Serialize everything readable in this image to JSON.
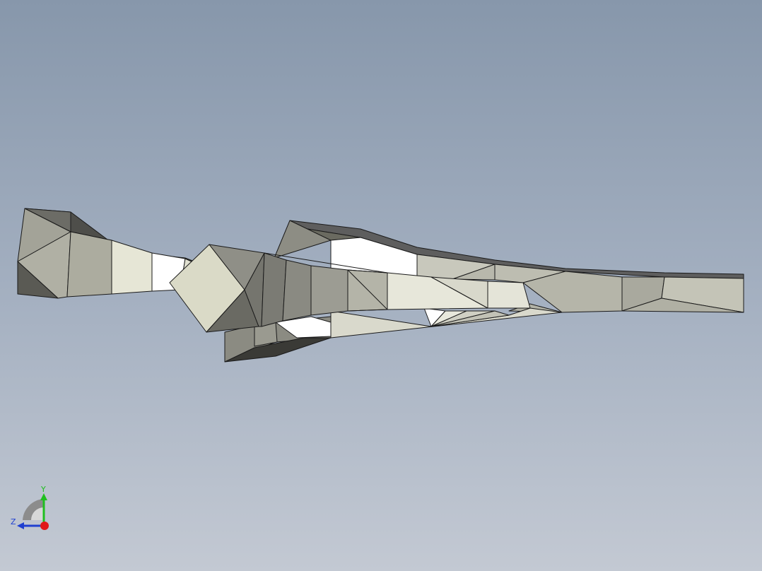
{
  "viewport": {
    "background_top": "#8797ab",
    "background_bottom": "#c3c9d3",
    "model_edge_color": "#1a1a1a"
  },
  "triad": {
    "y_label": "Y",
    "z_label": "Z",
    "y_color": "#1fbf1f",
    "z_color": "#1f3fd0",
    "x_color": "#e01818"
  }
}
